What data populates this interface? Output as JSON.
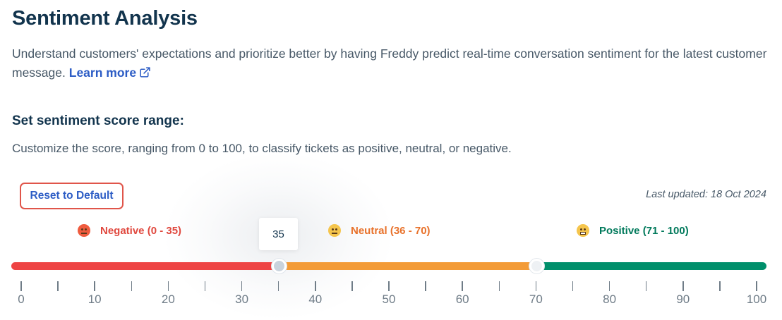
{
  "header": {
    "title": "Sentiment Analysis",
    "description": "Understand customers' expectations and prioritize better by having Freddy predict real-time conversation sentiment for the latest customer message.",
    "learn_more": "Learn more"
  },
  "section": {
    "title": "Set sentiment score range:",
    "subtitle": "Customize the score, ranging from 0 to 100, to classify tickets as positive, neutral, or negative."
  },
  "controls": {
    "reset_label": "Reset to Default",
    "last_updated": "Last updated: 18 Oct 2024"
  },
  "ranges": {
    "negative": {
      "label": "Negative (0 - 35)",
      "color": "#ee4444",
      "icon": "angry-face-icon"
    },
    "neutral": {
      "label": "Neutral (36 - 70)",
      "color": "#f39b37",
      "icon": "neutral-face-icon"
    },
    "positive": {
      "label": "Positive (71 - 100)",
      "color": "#008f6b",
      "icon": "grimacing-face-icon"
    }
  },
  "slider": {
    "min": 0,
    "max": 100,
    "handle_values": [
      35,
      70
    ],
    "tooltip": "35",
    "tick_labels": [
      "0",
      "10",
      "20",
      "30",
      "40",
      "50",
      "60",
      "70",
      "80",
      "90",
      "100"
    ]
  }
}
